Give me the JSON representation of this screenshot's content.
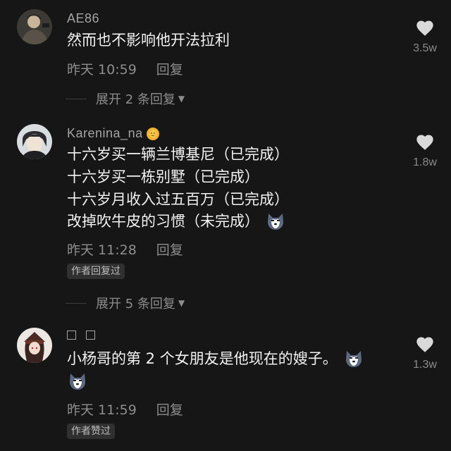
{
  "comments": [
    {
      "username": "AE86",
      "lines": [
        "然而也不影响他开法拉利"
      ],
      "time": "昨天 10:59",
      "reply_label": "回复",
      "likes": "3.5w",
      "badge": "",
      "expand": "展开 2 条回复"
    },
    {
      "username": "Karenina_na",
      "username_emoji": "sun-emoji",
      "lines": [
        "十六岁买一辆兰博基尼（已完成）",
        "十六岁买一栋别墅（已完成）",
        "十六岁月收入过五百万（已完成）",
        "改掉吹牛皮的习惯（未完成）"
      ],
      "time": "昨天 11:28",
      "reply_label": "回复",
      "likes": "1.8w",
      "badge": "作者回复过",
      "expand": "展开 5 条回复"
    },
    {
      "username": "",
      "lines": [
        "小杨哥的第 2 个女朋友是他现在的嫂子。"
      ],
      "time": "昨天 11:59",
      "reply_label": "回复",
      "likes": "1.3w",
      "badge": "作者赞过"
    }
  ],
  "icons": {
    "like": "heart-icon",
    "expand": "triangle-down-icon",
    "emoji": "husky-dog-emoji"
  },
  "colors": {
    "background": "#161616",
    "text": "#f2f2f2",
    "muted": "#8d8d8d"
  }
}
